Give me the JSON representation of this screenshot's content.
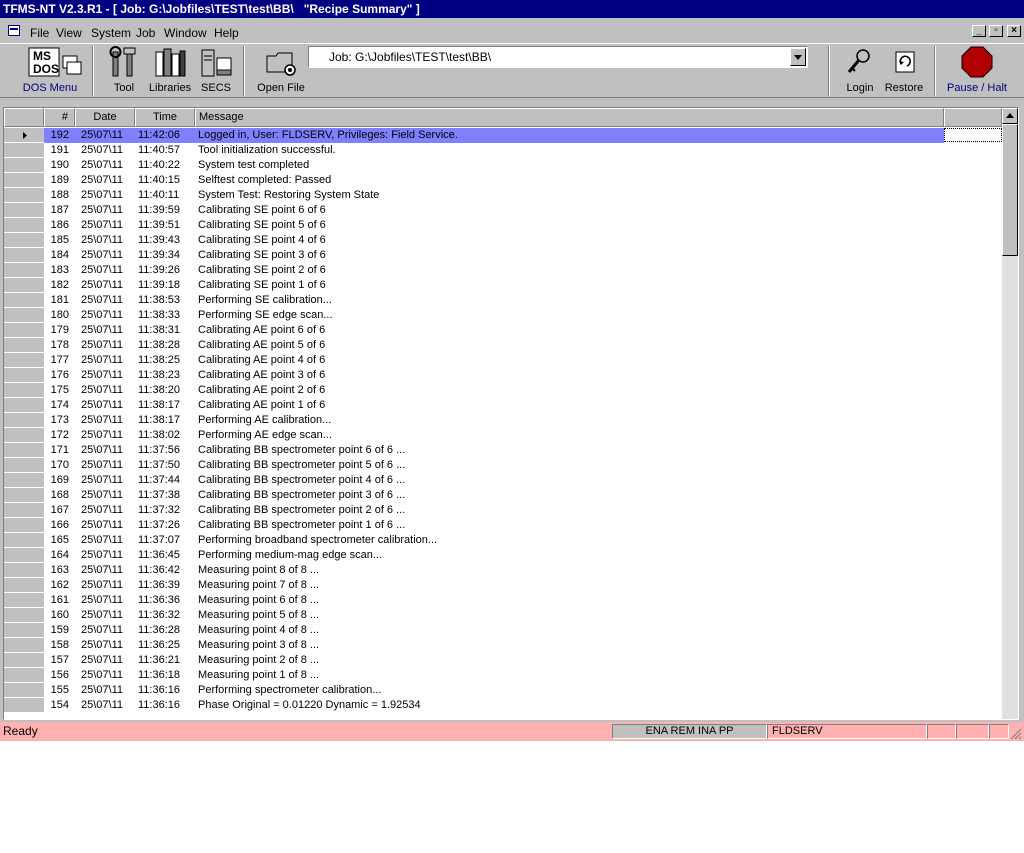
{
  "window": {
    "title": "TFMS-NT V2.3.R1 - [ Job: G:\\Jobfiles\\TEST\\test\\BB\\   \"Recipe Summary\" ]"
  },
  "menu": [
    "File",
    "View",
    "System",
    "Job",
    "Window",
    "Help"
  ],
  "toolbar": {
    "dos_label": "DOS Menu",
    "tool_label": "Tool",
    "libraries_label": "Libraries",
    "secs_label": "SECS",
    "openfile_label": "Open File",
    "job_value": "Job:  G:\\Jobfiles\\TEST\\test\\BB\\",
    "login_label": "Login",
    "restore_label": "Restore",
    "pause_label": "Pause / Halt"
  },
  "table": {
    "headers": [
      "#",
      "Date",
      "Time",
      "Message"
    ],
    "rows": [
      [
        "192",
        "25\\07\\11",
        "11:42:06",
        "Logged in, User: FLDSERV, Privileges: Field Service."
      ],
      [
        "191",
        "25\\07\\11",
        "11:40:57",
        "Tool initialization successful."
      ],
      [
        "190",
        "25\\07\\11",
        "11:40:22",
        "System test completed"
      ],
      [
        "189",
        "25\\07\\11",
        "11:40:15",
        "Selftest completed: Passed"
      ],
      [
        "188",
        "25\\07\\11",
        "11:40:11",
        "System Test: Restoring System State"
      ],
      [
        "187",
        "25\\07\\11",
        "11:39:59",
        "Calibrating SE point 6 of 6"
      ],
      [
        "186",
        "25\\07\\11",
        "11:39:51",
        "Calibrating SE point 5 of 6"
      ],
      [
        "185",
        "25\\07\\11",
        "11:39:43",
        "Calibrating SE point 4 of 6"
      ],
      [
        "184",
        "25\\07\\11",
        "11:39:34",
        "Calibrating SE point 3 of 6"
      ],
      [
        "183",
        "25\\07\\11",
        "11:39:26",
        "Calibrating SE point 2 of 6"
      ],
      [
        "182",
        "25\\07\\11",
        "11:39:18",
        "Calibrating SE point 1 of 6"
      ],
      [
        "181",
        "25\\07\\11",
        "11:38:53",
        "Performing SE calibration..."
      ],
      [
        "180",
        "25\\07\\11",
        "11:38:33",
        "Performing SE edge scan..."
      ],
      [
        "179",
        "25\\07\\11",
        "11:38:31",
        "Calibrating AE point 6 of 6"
      ],
      [
        "178",
        "25\\07\\11",
        "11:38:28",
        "Calibrating AE point 5 of 6"
      ],
      [
        "177",
        "25\\07\\11",
        "11:38:25",
        "Calibrating AE point 4 of 6"
      ],
      [
        "176",
        "25\\07\\11",
        "11:38:23",
        "Calibrating AE point 3 of 6"
      ],
      [
        "175",
        "25\\07\\11",
        "11:38:20",
        "Calibrating AE point 2 of 6"
      ],
      [
        "174",
        "25\\07\\11",
        "11:38:17",
        "Calibrating AE point 1 of 6"
      ],
      [
        "173",
        "25\\07\\11",
        "11:38:17",
        "Performing AE calibration..."
      ],
      [
        "172",
        "25\\07\\11",
        "11:38:02",
        "Performing AE edge scan..."
      ],
      [
        "171",
        "25\\07\\11",
        "11:37:56",
        "Calibrating BB spectrometer point 6 of 6 ..."
      ],
      [
        "170",
        "25\\07\\11",
        "11:37:50",
        "Calibrating BB spectrometer point 5 of 6 ..."
      ],
      [
        "169",
        "25\\07\\11",
        "11:37:44",
        "Calibrating BB spectrometer point 4 of 6 ..."
      ],
      [
        "168",
        "25\\07\\11",
        "11:37:38",
        "Calibrating BB spectrometer point 3 of 6 ..."
      ],
      [
        "167",
        "25\\07\\11",
        "11:37:32",
        "Calibrating BB spectrometer point 2 of 6 ..."
      ],
      [
        "166",
        "25\\07\\11",
        "11:37:26",
        "Calibrating BB spectrometer point 1 of 6 ..."
      ],
      [
        "165",
        "25\\07\\11",
        "11:37:07",
        "Performing broadband spectrometer calibration..."
      ],
      [
        "164",
        "25\\07\\11",
        "11:36:45",
        "Performing medium-mag edge scan..."
      ],
      [
        "163",
        "25\\07\\11",
        "11:36:42",
        "Measuring point 8 of 8 ..."
      ],
      [
        "162",
        "25\\07\\11",
        "11:36:39",
        "Measuring point 7 of 8 ..."
      ],
      [
        "161",
        "25\\07\\11",
        "11:36:36",
        "Measuring point 6 of 8 ..."
      ],
      [
        "160",
        "25\\07\\11",
        "11:36:32",
        "Measuring point 5 of 8 ..."
      ],
      [
        "159",
        "25\\07\\11",
        "11:36:28",
        "Measuring point 4 of 8 ..."
      ],
      [
        "158",
        "25\\07\\11",
        "11:36:25",
        "Measuring point 3 of 8 ..."
      ],
      [
        "157",
        "25\\07\\11",
        "11:36:21",
        "Measuring point 2 of 8 ..."
      ],
      [
        "156",
        "25\\07\\11",
        "11:36:18",
        "Measuring point 1 of 8 ..."
      ],
      [
        "155",
        "25\\07\\11",
        "11:36:16",
        "Performing spectrometer calibration..."
      ],
      [
        "154",
        "25\\07\\11",
        "11:36:16",
        "Phase  Original = 0.01220  Dynamic = 1.92534"
      ]
    ]
  },
  "status": {
    "ready": "Ready",
    "flags": "ENA REM INA PP",
    "user": "FLDSERV"
  },
  "colors": {
    "title_bg": "#000080",
    "selection": "#8080ff",
    "status_bg": "#ffb0b0",
    "pause_red": "#b00000"
  }
}
